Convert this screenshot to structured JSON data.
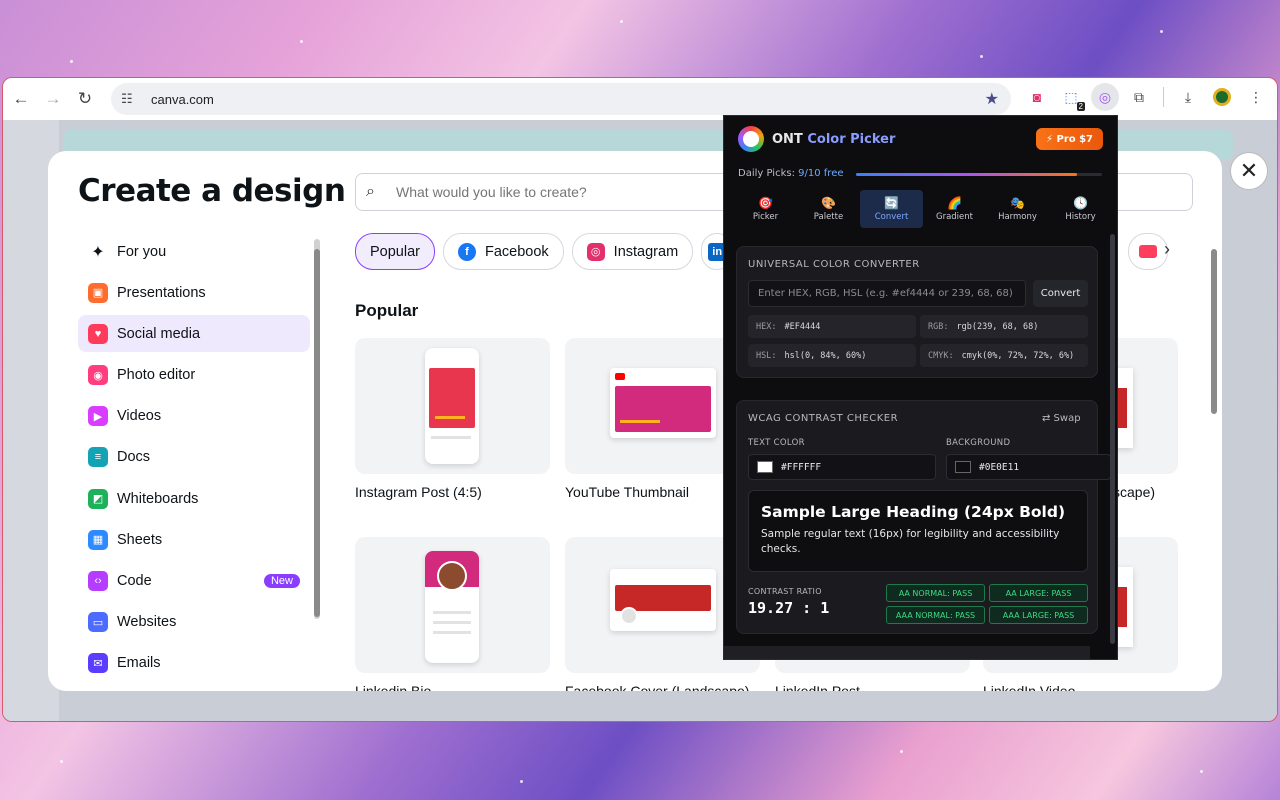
{
  "browser": {
    "url": "canva.com",
    "extension_badge": "2"
  },
  "modal": {
    "title": "Create a design",
    "search_placeholder": "What would you like to create?",
    "menu": [
      {
        "label": "For you",
        "icon": "sparkle-icon",
        "color": "#0e1318"
      },
      {
        "label": "Presentations",
        "icon": "presentation-icon",
        "color": "#ff6d2e"
      },
      {
        "label": "Social media",
        "icon": "heart-icon",
        "color": "#ff3b5c"
      },
      {
        "label": "Photo editor",
        "icon": "camera-icon",
        "color": "#ff3d7f"
      },
      {
        "label": "Videos",
        "icon": "video-icon",
        "color": "#d93dff"
      },
      {
        "label": "Docs",
        "icon": "doc-icon",
        "color": "#13a3b5"
      },
      {
        "label": "Whiteboards",
        "icon": "whiteboard-icon",
        "color": "#1db15a"
      },
      {
        "label": "Sheets",
        "icon": "sheets-icon",
        "color": "#2e8bff"
      },
      {
        "label": "Code",
        "icon": "code-icon",
        "color": "#b63dff"
      },
      {
        "label": "Websites",
        "icon": "website-icon",
        "color": "#4d6bff"
      },
      {
        "label": "Emails",
        "icon": "email-icon",
        "color": "#5b3dff"
      }
    ],
    "code_badge": "New",
    "chips": [
      {
        "label": "Popular",
        "icon": "",
        "color": ""
      },
      {
        "label": "Facebook",
        "icon": "f",
        "color": "#1877f2"
      },
      {
        "label": "Instagram",
        "icon": "◎",
        "color": "#e1306c"
      }
    ],
    "section_title": "Popular",
    "cards": [
      {
        "label": "Instagram Post (4:5)"
      },
      {
        "label": "YouTube Thumbnail"
      },
      {
        "label": "scape)"
      },
      {
        "label": "Linkedin Bio"
      },
      {
        "label": "Facebook Cover (Landscape)"
      },
      {
        "label": "LinkedIn Post"
      },
      {
        "label": "LinkedIn Video"
      }
    ]
  },
  "popup": {
    "title_main": "ONT",
    "title_accent": "Color Picker",
    "pro_label": "⚡ Pro $7",
    "daily_label": "Daily Picks:",
    "daily_count": "9/10 free",
    "daily_progress": 0.9,
    "tabs": [
      {
        "label": "Picker",
        "icon": "picker-icon",
        "glyph": "🎯"
      },
      {
        "label": "Palette",
        "icon": "palette-icon",
        "glyph": "🎨"
      },
      {
        "label": "Convert",
        "icon": "convert-icon",
        "glyph": "🔄"
      },
      {
        "label": "Gradient",
        "icon": "gradient-icon",
        "glyph": "🌈"
      },
      {
        "label": "Harmony",
        "icon": "harmony-icon",
        "glyph": "🎭"
      },
      {
        "label": "History",
        "icon": "history-icon",
        "glyph": "🕓"
      }
    ],
    "converter": {
      "heading": "UNIVERSAL COLOR CONVERTER",
      "placeholder": "Enter HEX, RGB, HSL (e.g. #ef4444 or 239, 68, 68)",
      "button": "Convert",
      "hex_key": "HEX:",
      "hex_val": "#EF4444",
      "rgb_key": "RGB:",
      "rgb_val": "rgb(239, 68, 68)",
      "hsl_key": "HSL:",
      "hsl_val": "hsl(0, 84%, 60%)",
      "cmyk_key": "CMYK:",
      "cmyk_val": "cmyk(0%, 72%, 72%, 6%)"
    },
    "contrast": {
      "heading": "WCAG CONTRAST CHECKER",
      "swap": "⇄ Swap",
      "text_label": "TEXT COLOR",
      "bg_label": "BACKGROUND",
      "text_color": "#FFFFFF",
      "bg_color": "#0E0E11",
      "sample_heading": "Sample Large Heading (24px Bold)",
      "sample_text": "Sample regular text (16px) for legibility and accessibility checks.",
      "ratio_label": "CONTRAST RATIO",
      "ratio_value": "19.27 : 1",
      "aa_normal": "AA NORMAL: PASS",
      "aa_large": "AA LARGE: PASS",
      "aaa_normal": "AAA NORMAL: PASS",
      "aaa_large": "AAA LARGE: PASS"
    }
  }
}
